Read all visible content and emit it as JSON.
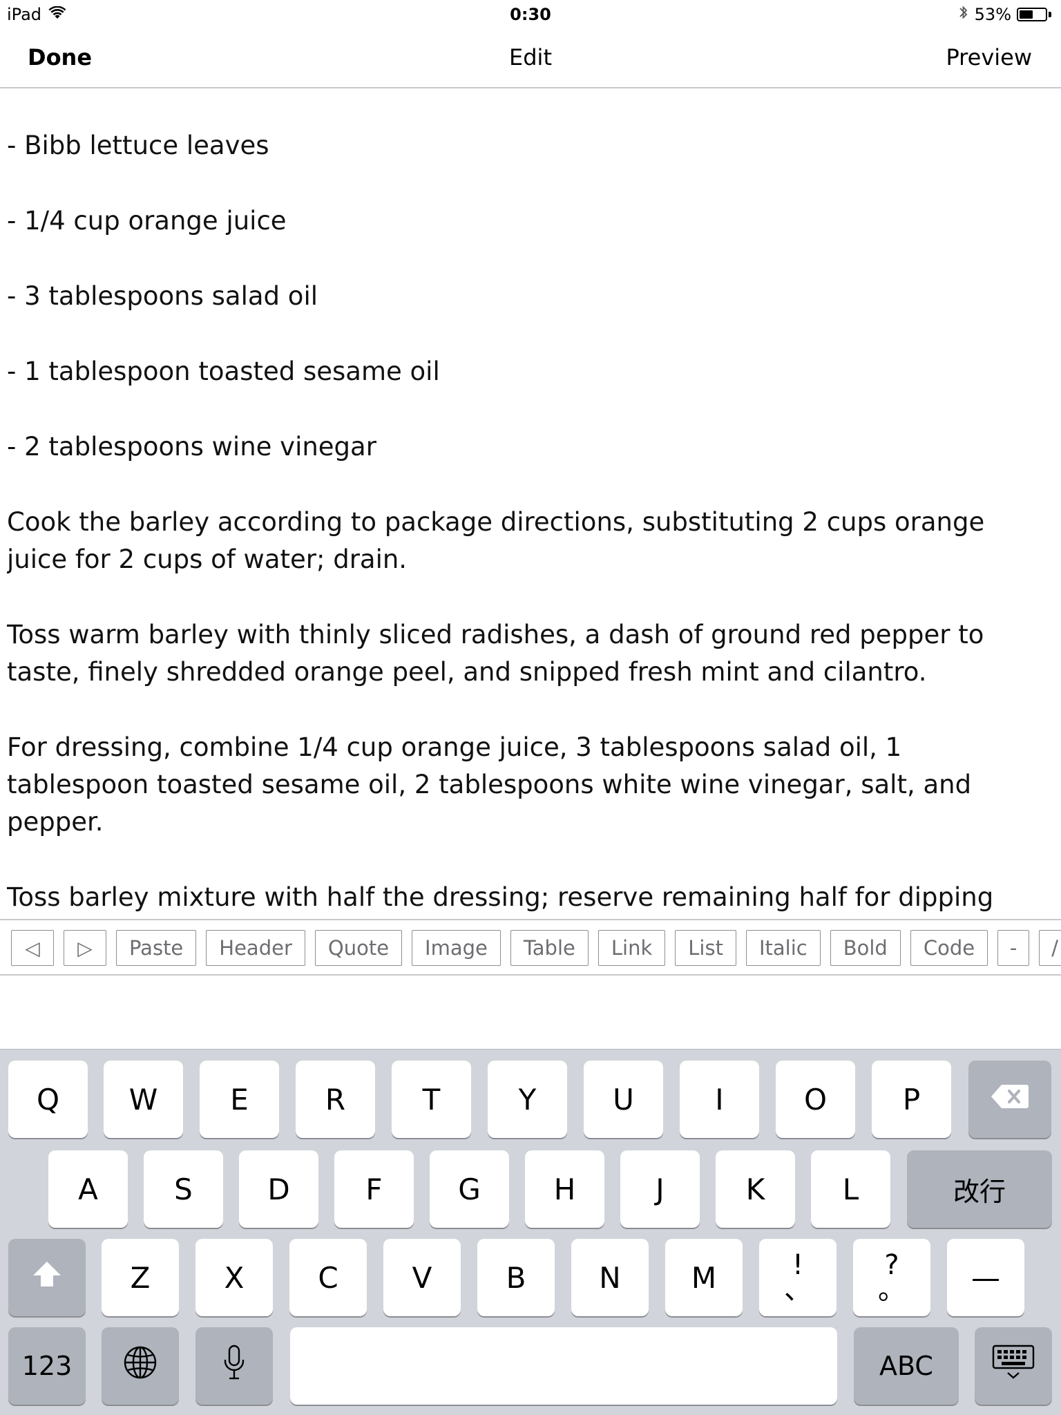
{
  "status_bar": {
    "device": "iPad",
    "time": "0:30",
    "battery": "53%",
    "battery_level": 0.53
  },
  "nav": {
    "done_label": "Done",
    "title": "Edit",
    "preview_label": "Preview"
  },
  "editor": {
    "paragraphs": [
      "- Bibb lettuce leaves",
      "- 1/4 cup orange juice",
      "- 3 tablespoons salad oil",
      "- 1 tablespoon toasted sesame oil",
      "- 2 tablespoons wine vinegar",
      "Cook the barley according to package directions, substituting 2 cups orange juice for 2 cups of water; drain.",
      "Toss warm barley with thinly sliced radishes, a dash of ground red pepper to taste, finely shredded orange peel, and snipped fresh mint and cilantro.",
      "For dressing, combine 1/4 cup orange juice, 3 tablespoons salad oil, 1 tablespoon toasted sesame oil, 2 tablespoons white wine vinegar, salt, and pepper.",
      "Toss barley mixture with half the dressing; reserve remaining half for dipping sauce. Add chicken."
    ]
  },
  "toolbar": {
    "left_arrow": "◁",
    "right_arrow": "▷",
    "paste": "Paste",
    "header": "Header",
    "quote": "Quote",
    "image": "Image",
    "table": "Table",
    "link": "Link",
    "list": "List",
    "italic": "Italic",
    "bold": "Bold",
    "code": "Code",
    "dash": "-",
    "slash": "/"
  },
  "keyboard": {
    "row1": [
      "Q",
      "W",
      "E",
      "R",
      "T",
      "Y",
      "U",
      "I",
      "O",
      "P"
    ],
    "row2": [
      "A",
      "S",
      "D",
      "F",
      "G",
      "H",
      "J",
      "K",
      "L"
    ],
    "row3": [
      "Z",
      "X",
      "C",
      "V",
      "B",
      "N",
      "M"
    ],
    "return_label": "改行",
    "punct1_top": "!",
    "punct1_bottom": "、",
    "punct2_top": "?",
    "punct2_bottom": "。",
    "dash_key": "—",
    "numbers_label": "123",
    "abc_label": "ABC",
    "icons": {
      "delete": "delete-icon",
      "shift": "shift-icon",
      "globe": "globe-icon",
      "mic": "microphone-icon",
      "dismiss": "keyboard-dismiss-icon"
    }
  }
}
